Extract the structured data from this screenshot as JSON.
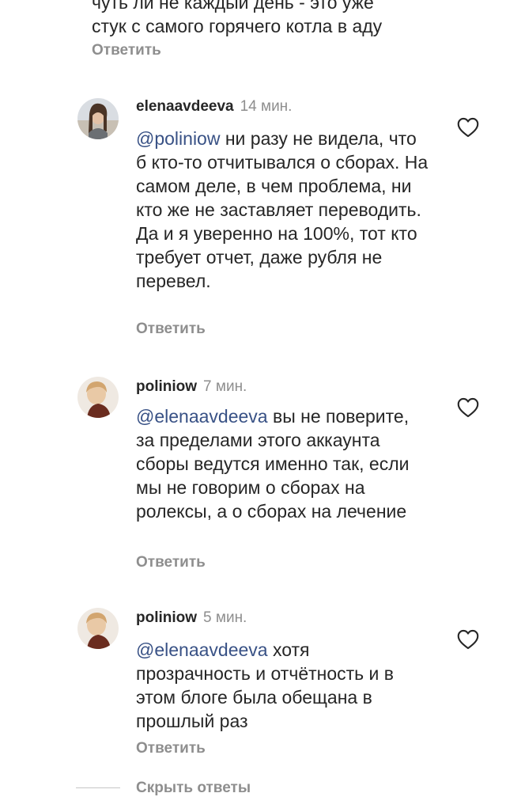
{
  "top_fragment": {
    "lines": [
      "чуть ли не каждый день - это уже",
      "стук с самого горячего котла в аду"
    ],
    "reply": "Ответить"
  },
  "comments": [
    {
      "username": "elenaavdeeva",
      "time": "14 мин.",
      "mention": "@poliniow",
      "text": " ни разу не видела, что б кто-то отчитывался о сборах. На самом деле, в чем проблема, ни кто же не заставляет переводить. Да и я уверенно на 100%, тот кто требует отчет, даже рубля не перевел.",
      "reply": "Ответить",
      "like_icon": "heart-outline"
    },
    {
      "username": "poliniow",
      "time": "7 мин.",
      "mention": "@elenaavdeeva",
      "text": " вы не поверите, за пределами этого аккаунта сборы ведутся именно так, если мы не говорим о сборах на ролексы, а о сборах на лечение",
      "reply": "Ответить",
      "like_icon": "heart-outline"
    },
    {
      "username": "poliniow",
      "time": "5 мин.",
      "mention": "@elenaavdeeva",
      "text": " хотя прозрачность и отчётность и в этом блоге была обещана в прошлый раз",
      "reply": "Ответить",
      "like_icon": "heart-outline"
    }
  ],
  "hide_replies": "Скрыть ответы"
}
